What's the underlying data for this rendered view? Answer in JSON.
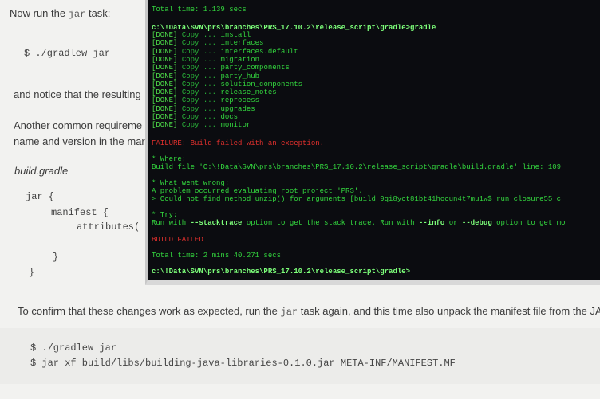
{
  "doc": {
    "line1_pre": "Now run the",
    "line1_code": "jar",
    "line1_post": "task:",
    "cmd1": "$ ./gradlew jar",
    "line2": "and notice that the resulting",
    "line3": "Another common requireme",
    "line4": "name and version in the mar",
    "filename": "build.gradle",
    "code_lines": [
      "jar {",
      "manifest {",
      "attributes(",
      "}",
      "}"
    ],
    "confirm_pre": "To confirm that these changes work as expected, run the",
    "confirm_code": "jar",
    "confirm_post": "task again, and this time also unpack the manifest file from the JAR",
    "cmd2": "$ ./gradlew jar",
    "cmd3": "$ jar xf build/libs/building-java-libraries-0.1.0.jar META-INF/MANIFEST.MF"
  },
  "terminal": {
    "total_time_top": "Total time: 1.139 secs",
    "prompt1": "c:\\!Data\\SVN\\prs\\branches\\PRS_17.10.2\\release_script\\gradle>gradle",
    "done_items": [
      "install",
      "interfaces",
      "interfaces.default",
      "migration",
      "party_components",
      "party_hub",
      "solution_components",
      "release_notes",
      "reprocess",
      "upgrades",
      "docs",
      "monitor"
    ],
    "done_tag": "[DONE]",
    "copy_word": "Copy ...",
    "failure": "FAILURE: Build failed with an exception.",
    "where_head": "* Where:",
    "where_line": "Build file 'C:\\!Data\\SVN\\prs\\branches\\PRS_17.10.2\\release_script\\gradle\\build.gradle' line: 109",
    "wrong_head": "* What went wrong:",
    "wrong_line1": "A problem occurred evaluating root project 'PRS'.",
    "wrong_line2": "> Could not find method unzip() for arguments [build_9qi8yot81bt41hooun4t7mu1w$_run_closure55_c",
    "try_head": "* Try:",
    "try_pre": "Run with",
    "try_st": "--stacktrace",
    "try_mid": "option to get the stack trace. Run with",
    "try_info": "--info",
    "try_or": "or",
    "try_debug": "--debug",
    "try_post": "option to get mo",
    "build_failed": "BUILD FAILED",
    "total_time_bottom": "Total time: 2 mins 40.271 secs",
    "prompt2": "c:\\!Data\\SVN\\prs\\branches\\PRS_17.10.2\\release_script\\gradle>"
  }
}
